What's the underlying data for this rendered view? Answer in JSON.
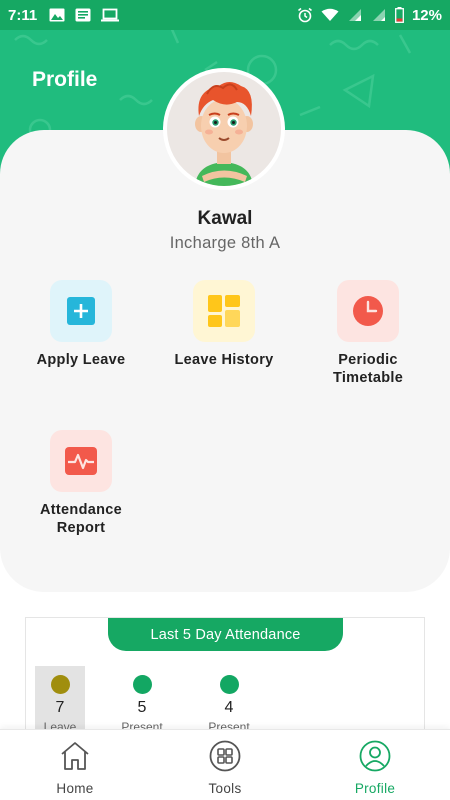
{
  "status_bar": {
    "time": "7:11",
    "battery": "12%",
    "left_icons": [
      "image-icon",
      "news-icon",
      "laptop-icon"
    ],
    "right_icons": [
      "alarm-icon",
      "wifi-icon",
      "signal-icon",
      "signal-icon",
      "battery-icon"
    ]
  },
  "header": {
    "title": "Profile",
    "color": "#20bc7e"
  },
  "user": {
    "name": "Kawal",
    "role": "Incharge 8th A"
  },
  "actions": [
    {
      "label": "Apply Leave",
      "icon": "plus-square-icon",
      "bg": "#dff4fa",
      "color": "#26b6da"
    },
    {
      "label": "Leave History",
      "icon": "dashboard-grid-icon",
      "bg": "#fff6d4",
      "color": "#ffc61a"
    },
    {
      "label": "Periodic Timetable",
      "icon": "clock-icon",
      "bg": "#fde4e1",
      "color": "#f2594b"
    },
    {
      "label": "Attendance Report",
      "icon": "pulse-chart-icon",
      "bg": "#fde4e1",
      "color": "#f2594b"
    }
  ],
  "attendance": {
    "title": "Last 5 Day Attendance",
    "items": [
      {
        "count": "7",
        "label": "Leave",
        "color": "#a08e0e"
      },
      {
        "count": "5",
        "label": "Present",
        "color": "#13a763"
      },
      {
        "count": "4",
        "label": "Present",
        "color": "#13a763"
      }
    ]
  },
  "nav": {
    "items": [
      {
        "label": "Home",
        "icon": "home-icon"
      },
      {
        "label": "Tools",
        "icon": "grid-icon"
      },
      {
        "label": "Profile",
        "icon": "user-icon"
      }
    ],
    "active_color": "#16a863"
  }
}
